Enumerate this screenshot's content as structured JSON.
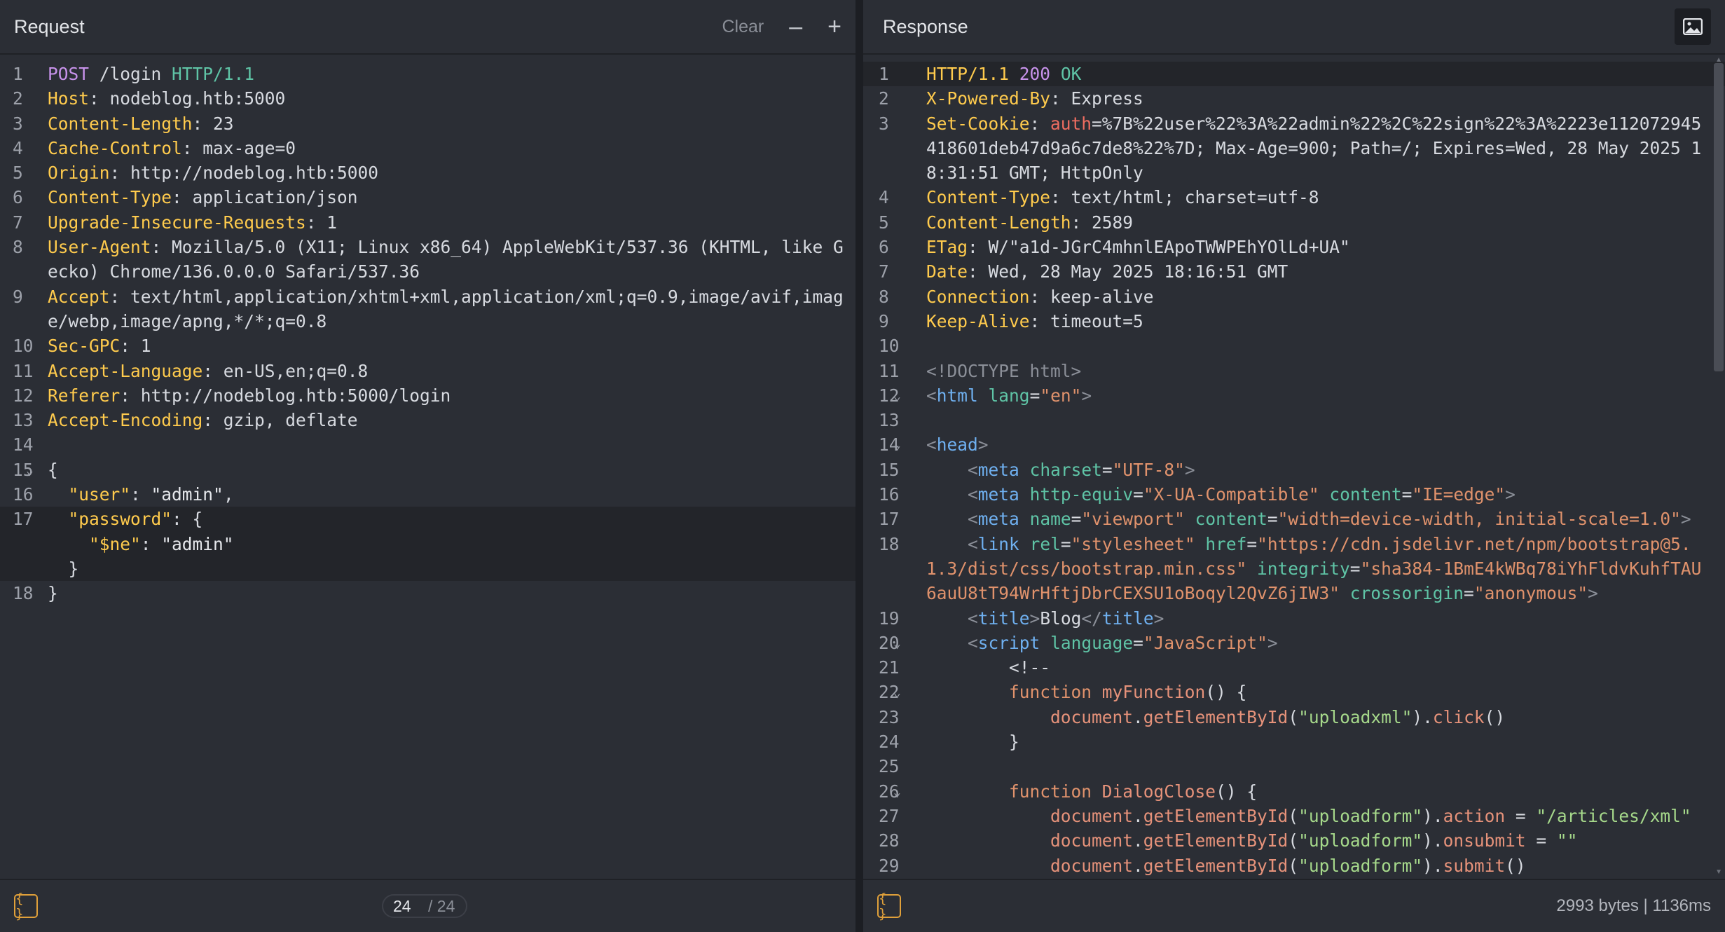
{
  "request": {
    "title": "Request",
    "clear_label": "Clear",
    "minus_icon": "–",
    "plus_icon": "+",
    "format_label": "{ }",
    "page_current": "24",
    "page_total": "/ 24"
  },
  "response": {
    "title": "Response",
    "format_label": "{ }",
    "stats": "2993 bytes  |  1136ms"
  },
  "colors": {
    "background": "#2b2e35",
    "header_key": "#ffcb4d",
    "method": "#c792ea",
    "protocol": "#5fc4a6",
    "tag": "#6fb0f0",
    "attr_value": "#e0926c",
    "format_icon": "#e0a03a"
  },
  "icons": {
    "image_icon": "image-icon",
    "fold_icon": "chevron-down-icon"
  }
}
